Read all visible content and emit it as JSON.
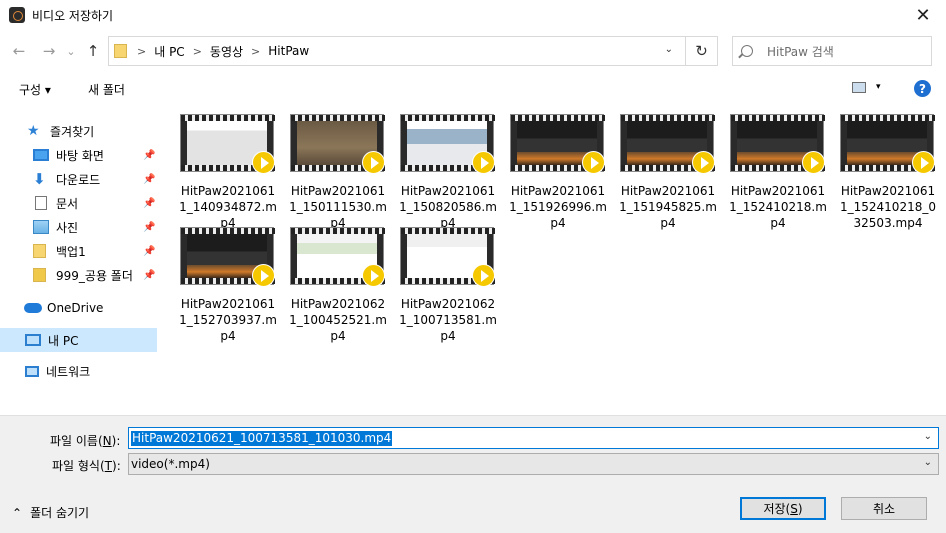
{
  "window": {
    "title": "비디오 저장하기",
    "close_glyph": "✕"
  },
  "nav": {
    "back": "←",
    "forward": "→",
    "recent": "⌄",
    "up": "↑",
    "breadcrumb": [
      "내 PC",
      "동영상",
      "HitPaw"
    ],
    "crumb_sep": ">",
    "addr_dropdown": "⌄",
    "refresh": "↻",
    "search_placeholder": "HitPaw 검색"
  },
  "toolbar": {
    "organize": "구성 ▾",
    "new_folder": "새 폴더",
    "view_dropdown": "▾",
    "help": "?"
  },
  "sidebar": {
    "quick_access": "즐겨찾기",
    "items": [
      {
        "label": "바탕 화면",
        "pinned": true
      },
      {
        "label": "다운로드",
        "pinned": true
      },
      {
        "label": "문서",
        "pinned": true
      },
      {
        "label": "사진",
        "pinned": true
      },
      {
        "label": "백업1",
        "pinned": true
      },
      {
        "label": "999_공용 폴더",
        "pinned": true
      }
    ],
    "pin_glyph": "📌",
    "onedrive": "OneDrive",
    "this_pc": "내 PC",
    "network": "네트워크"
  },
  "files": [
    {
      "name": "HitPaw20210611_140934872.mp4",
      "line1": "HitPaw2021061",
      "line2": "1_140934872.m",
      "line3": "p4",
      "thumb": "web1"
    },
    {
      "name": "HitPaw20210611_150111530.mp4",
      "line1": "HitPaw2021061",
      "line2": "1_150111530.m",
      "line3": "p4",
      "thumb": "crowd"
    },
    {
      "name": "HitPaw20210611_150820586.mp4",
      "line1": "HitPaw2021061",
      "line2": "1_150820586.m",
      "line3": "p4",
      "thumb": "lake"
    },
    {
      "name": "HitPaw20210611_151926996.mp4",
      "line1": "HitPaw2021061",
      "line2": "1_151926996.m",
      "line3": "p4",
      "thumb": "dark"
    },
    {
      "name": "HitPaw20210611_151945825.mp4",
      "line1": "HitPaw2021061",
      "line2": "1_151945825.m",
      "line3": "p4",
      "thumb": "dark"
    },
    {
      "name": "HitPaw20210611_152410218.mp4",
      "line1": "HitPaw2021061",
      "line2": "1_152410218.m",
      "line3": "p4",
      "thumb": "dark"
    },
    {
      "name": "HitPaw20210611_152410218_032503.mp4",
      "line1": "HitPaw2021061",
      "line2": "1_152410218_0",
      "line3": "32503.mp4",
      "thumb": "dark"
    },
    {
      "name": "HitPaw20210611_152703937.mp4",
      "line1": "HitPaw2021061",
      "line2": "1_152703937.m",
      "line3": "p4",
      "thumb": "dark"
    },
    {
      "name": "HitPaw20210621_100452521.mp4",
      "line1": "HitPaw2021062",
      "line2": "1_100452521.m",
      "line3": "p4",
      "thumb": "web2"
    },
    {
      "name": "HitPaw20210621_100713581.mp4",
      "line1": "HitPaw2021062",
      "line2": "1_100713581.m",
      "line3": "p4",
      "thumb": "web3"
    }
  ],
  "form": {
    "filename_label": "파일 이름(",
    "filename_key": "N",
    "filename_label_end": "):",
    "filename_value": "HitPaw20210621_100713581_101030.mp4",
    "filetype_label": "파일 형식(",
    "filetype_key": "T",
    "filetype_label_end": "):",
    "filetype_value": "video(*.mp4)",
    "dropdown_glyph": "⌄"
  },
  "footer": {
    "hide_folders_glyph": "⌃",
    "hide_folders": "폴더 숨기기",
    "save_label": "저장(",
    "save_key": "S",
    "save_label_end": ")",
    "cancel": "취소"
  }
}
